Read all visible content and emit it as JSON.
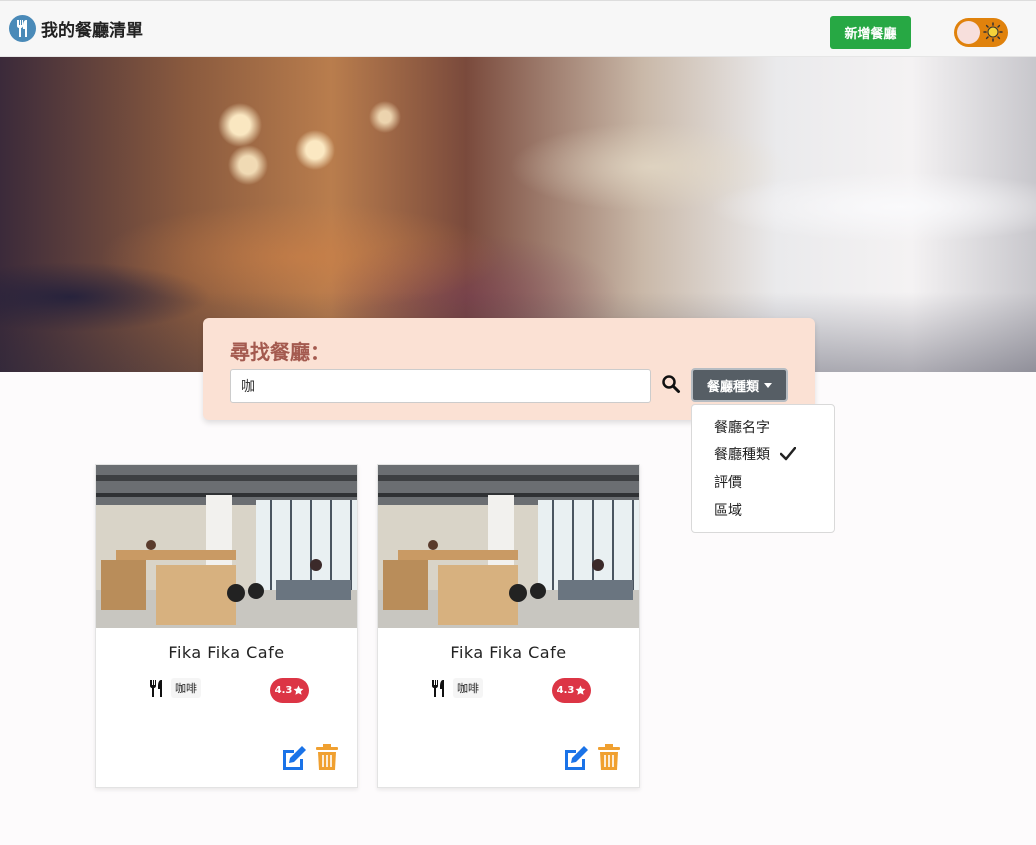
{
  "navbar": {
    "brand_title": "我的餐廳清單",
    "brand_icon": "utensils-icon",
    "add_button_label": "新增餐廳",
    "theme_toggle_icon": "sun-icon"
  },
  "search": {
    "heading": "尋找餐廳：",
    "input_value": "咖",
    "search_icon": "search-icon",
    "category_button_label": "餐廳種類"
  },
  "dropdown": {
    "items": [
      {
        "label": "餐廳名字",
        "checked": false
      },
      {
        "label": "餐廳種類",
        "checked": true
      },
      {
        "label": "評價",
        "checked": false
      },
      {
        "label": "區域",
        "checked": false
      }
    ]
  },
  "restaurants": [
    {
      "name": "Fika Fika Cafe",
      "category": "咖啡",
      "rating": "4.3"
    },
    {
      "name": "Fika Fika Cafe",
      "category": "咖啡",
      "rating": "4.3"
    }
  ],
  "colors": {
    "add_button": "#27a844",
    "toggle": "#e0820c",
    "rating_badge": "#dc3545",
    "edit_icon": "#1a73e8",
    "trash_icon": "#f0a030",
    "category_button": "#565e65",
    "search_panel": "#fbe1d4"
  }
}
